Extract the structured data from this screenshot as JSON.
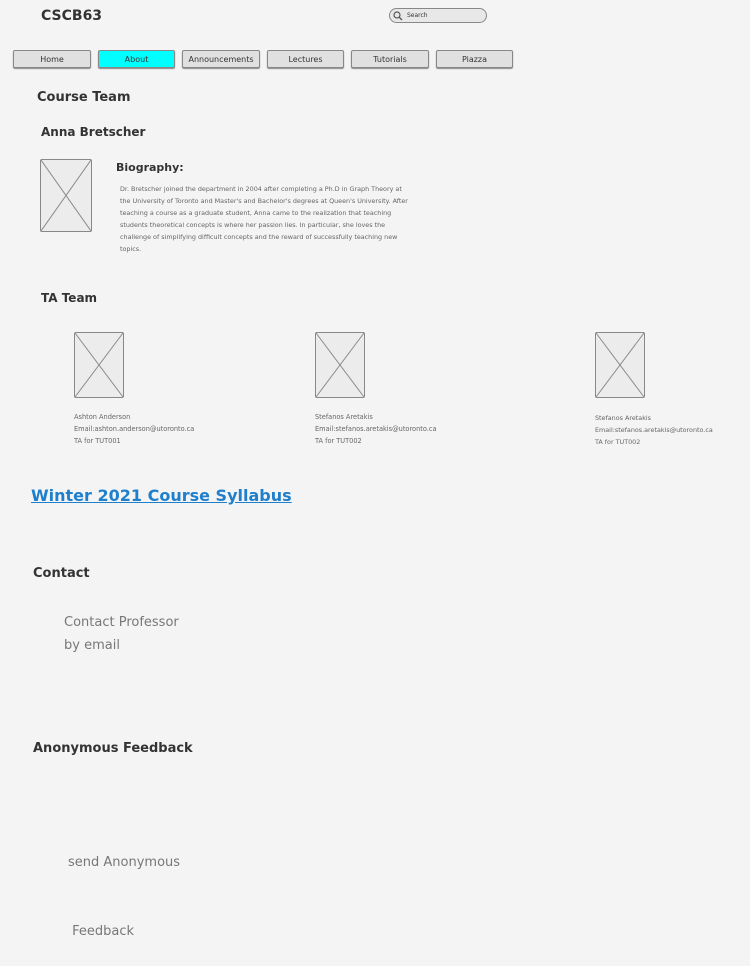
{
  "header": {
    "site_title": "CSCB63",
    "search": {
      "placeholder": "Search",
      "icon": "search-icon"
    }
  },
  "nav": {
    "items": [
      {
        "label": "Home",
        "active": false
      },
      {
        "label": "About",
        "active": true
      },
      {
        "label": "Announcements",
        "active": false
      },
      {
        "label": "Lectures",
        "active": false
      },
      {
        "label": "Tutorials",
        "active": false
      },
      {
        "label": "Piazza",
        "active": false
      }
    ],
    "active_color": "#00ffff"
  },
  "course_team": {
    "heading": "Course Team",
    "professor": {
      "name": "Anna Bretscher",
      "bio_heading": "Biography:",
      "bio_lines": [
        "Dr. Bretscher joined the department in 2004 after completing a Ph.D in Graph Theory at",
        "the University of Toronto and Master's and Bachelor's degrees at Queen's University. After",
        "teaching a course as a graduate student, Anna came to the realization that teaching",
        "students theoretical concepts is where her passion lies. In particular, she loves the",
        "challenge of simplifying difficult concepts and the reward of successfully teaching new",
        "topics."
      ]
    }
  },
  "ta_team": {
    "heading": "TA Team",
    "tas": [
      {
        "name": "Ashton Anderson",
        "email": "Email:ashton.anderson@utoronto.ca",
        "role": "TA for TUT001"
      },
      {
        "name": "Stefanos Aretakis",
        "email": "Email:stefanos.aretakis@utoronto.ca",
        "role": "TA for TUT002"
      },
      {
        "name": "Stefanos Aretakis",
        "email": "Email:stefanos.aretakis@utoronto.ca",
        "role": "TA for TUT002"
      }
    ]
  },
  "syllabus_link": "Winter 2021 Course Syllabus",
  "contact": {
    "heading": "Contact",
    "link_lines": [
      "Contact Professor",
      "by email"
    ]
  },
  "feedback": {
    "heading": "Anonymous Feedback",
    "link_lines": [
      "send Anonymous",
      " Feedback"
    ]
  }
}
